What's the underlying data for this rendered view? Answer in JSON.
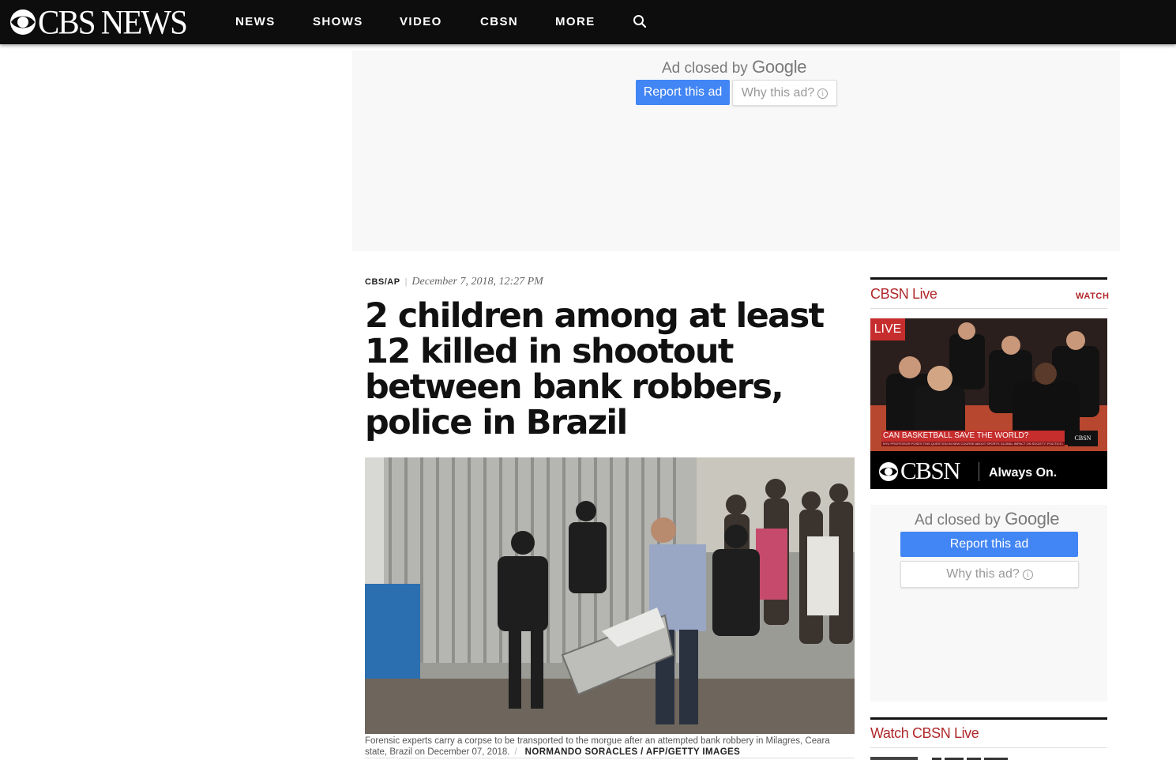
{
  "header": {
    "logo_text": "CBS NEWS",
    "nav": [
      "NEWS",
      "SHOWS",
      "VIDEO",
      "CBSN",
      "MORE"
    ],
    "search_icon": "search-icon"
  },
  "top_ad": {
    "closed_prefix": "Ad closed by",
    "closed_brand": "Google",
    "report_label": "Report this ad",
    "why_label": "Why this ad?"
  },
  "article": {
    "source": "CBS/AP",
    "date": "December 7, 2018, 12:27 PM",
    "headline": "2 children among at least 12 killed in shootout between bank robbers, police in Brazil",
    "caption": "Forensic experts carry a corpse to be transported to the morgue after an attempted bank robbery in Milagres, Ceara state, Brazil on December 07, 2018.",
    "caption_slash": "/",
    "credit": "NORMANDO SORACLES / AFP/GETTY IMAGES"
  },
  "rail": {
    "cbsn_title": "CBSN Live",
    "watch_label": "WATCH",
    "player": {
      "live_badge": "LIVE",
      "lower_third": "CAN BASKETBALL SAVE THE WORLD?",
      "lower_third_sub": "NYU PROFESSOR POSES THIS QUESTION IN NEW COURSE ABOUT SPORTS GLOBAL IMPACT ON SOCIETY, POLITICS & CULTURE",
      "corner_bug": "CBSN",
      "brand": "CBSN",
      "tagline": "Always On."
    },
    "side_ad": {
      "closed_prefix": "Ad closed by",
      "closed_brand": "Google",
      "report_label": "Report this ad",
      "why_label": "Why this ad?"
    },
    "watch_title": "Watch CBSN Live"
  },
  "colors": {
    "header_bg": "#0d0d0d",
    "accent_red": "#b0282b",
    "google_blue": "#4285f4",
    "ad_bg": "#f8f8f8"
  }
}
